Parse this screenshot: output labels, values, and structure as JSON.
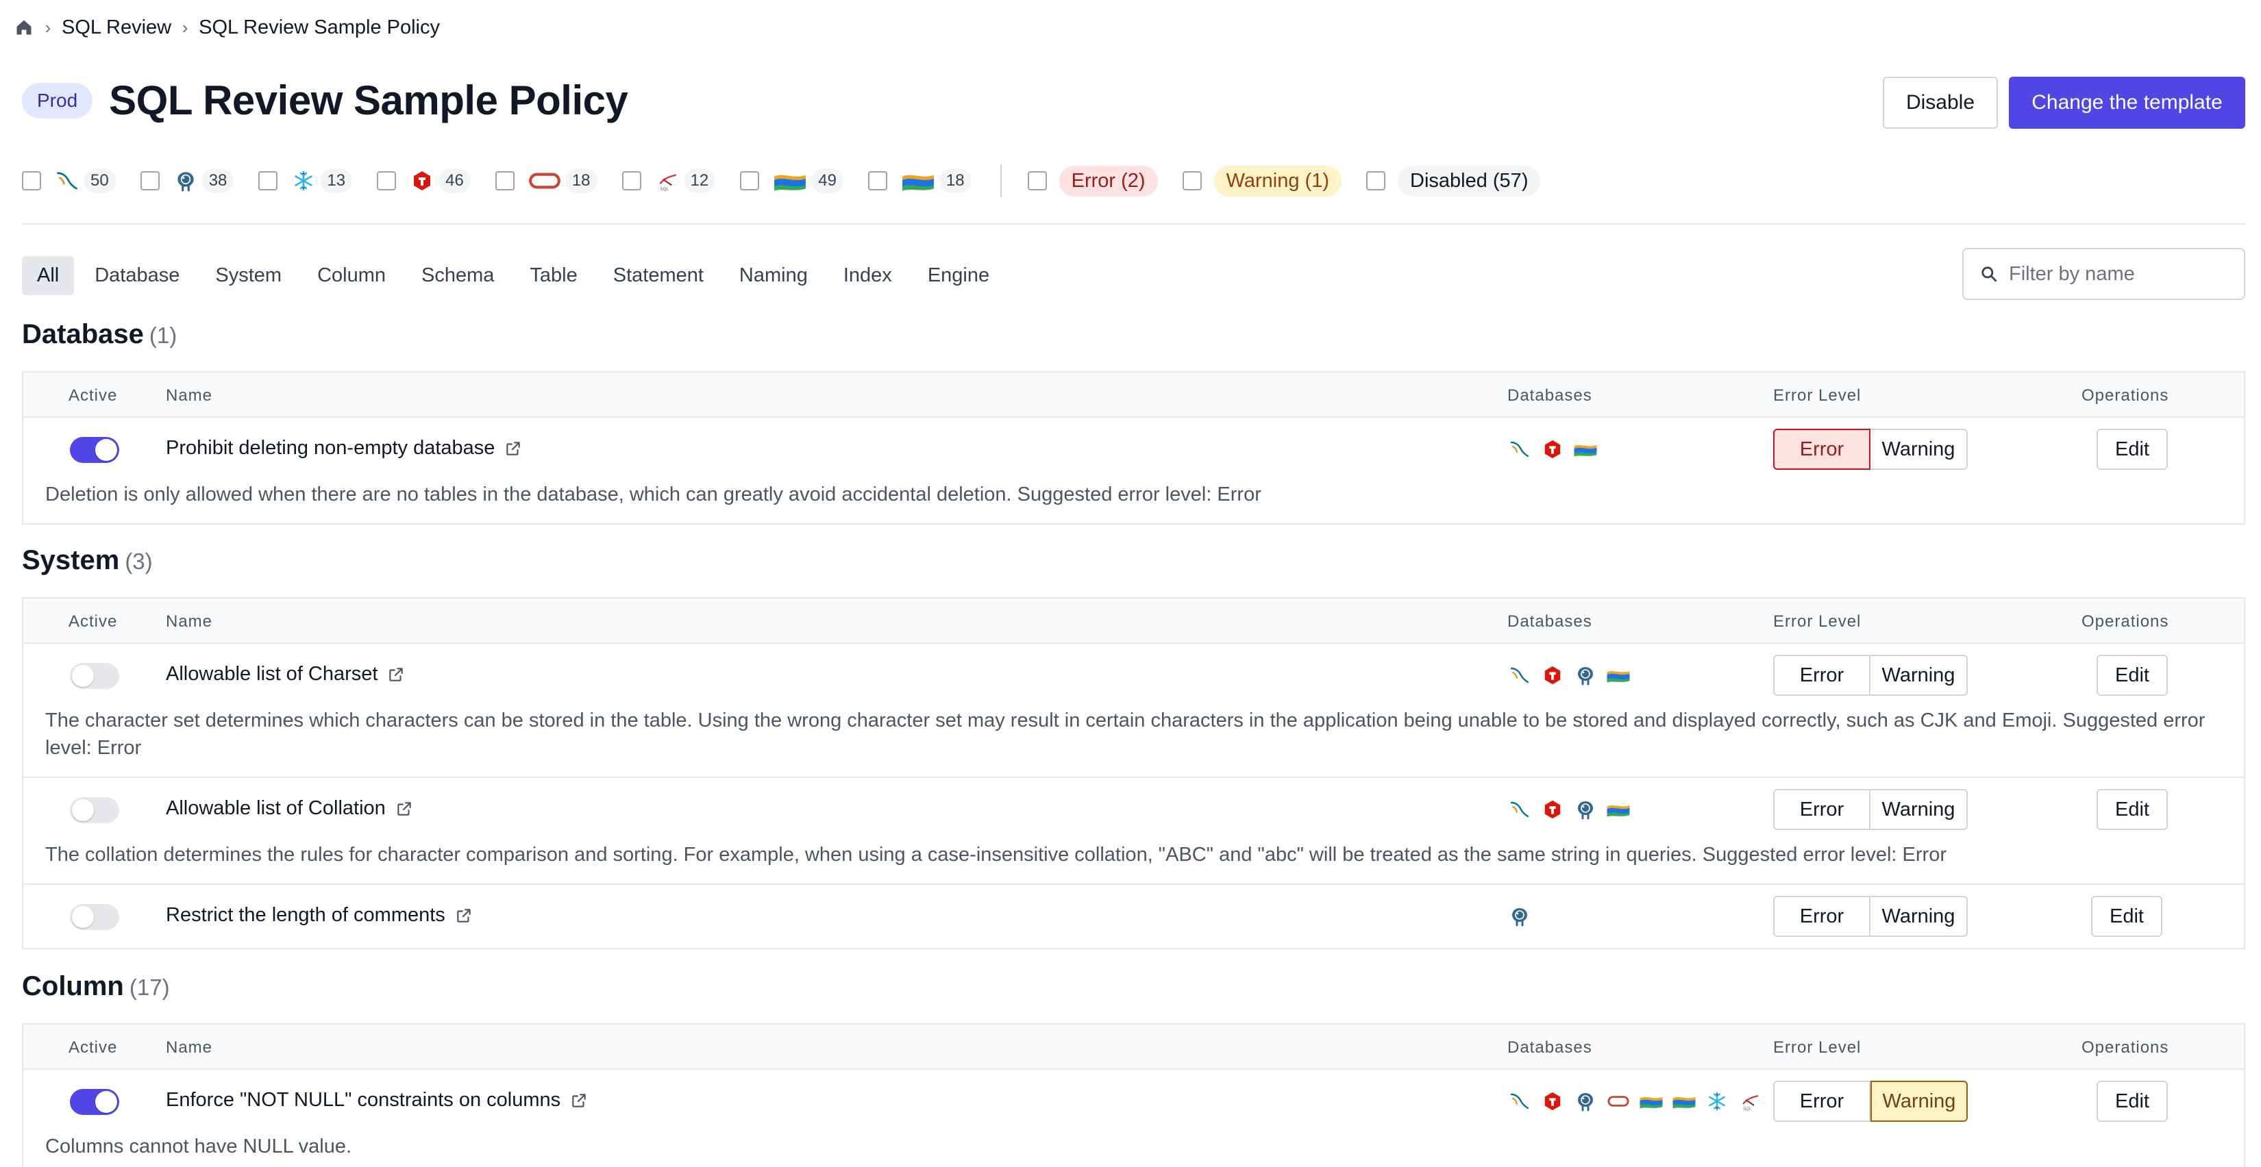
{
  "breadcrumb": {
    "items": [
      "SQL Review",
      "SQL Review Sample Policy"
    ]
  },
  "header": {
    "env": "Prod",
    "title": "SQL Review Sample Policy",
    "disable_label": "Disable",
    "change_label": "Change the template"
  },
  "engine_filters": [
    {
      "icon": "mysql-icon",
      "count": "50"
    },
    {
      "icon": "postgresql-icon",
      "count": "38"
    },
    {
      "icon": "snowflake-icon",
      "count": "13"
    },
    {
      "icon": "tidb-icon",
      "count": "46"
    },
    {
      "icon": "oracle-icon",
      "count": "18"
    },
    {
      "icon": "sqlserver-icon",
      "count": "12"
    },
    {
      "icon": "oceanbase-icon",
      "count": "49"
    },
    {
      "icon": "oceanbase-oracle-icon",
      "count": "18"
    }
  ],
  "level_filters": {
    "error": "Error (2)",
    "warning": "Warning (1)",
    "disabled": "Disabled (57)"
  },
  "tabs": [
    "All",
    "Database",
    "System",
    "Column",
    "Schema",
    "Table",
    "Statement",
    "Naming",
    "Index",
    "Engine"
  ],
  "search": {
    "placeholder": "Filter by name"
  },
  "columns": {
    "active": "Active",
    "name": "Name",
    "databases": "Databases",
    "error_level": "Error Level",
    "operations": "Operations"
  },
  "levels": {
    "error": "Error",
    "warning": "Warning",
    "edit": "Edit"
  },
  "sections": {
    "database": {
      "title": "Database",
      "count": "(1)",
      "rules": [
        {
          "name": "Prohibit deleting non-empty database",
          "active": true,
          "level": "error",
          "desc": "Deletion is only allowed when there are no tables in the database, which can greatly avoid accidental deletion. Suggested error level: Error"
        }
      ]
    },
    "system": {
      "title": "System",
      "count": "(3)",
      "rules": [
        {
          "name": "Allowable list of Charset",
          "active": false,
          "desc": "The character set determines which characters can be stored in the table. Using the wrong character set may result in certain characters in the application being unable to be stored and displayed correctly, such as CJK and Emoji. Suggested error level: Error"
        },
        {
          "name": "Allowable list of Collation",
          "active": false,
          "desc": "The collation determines the rules for character comparison and sorting. For example, when using a case-insensitive collation, \"ABC\" and \"abc\" will be treated as the same string in queries. Suggested error level: Error"
        },
        {
          "name": "Restrict the length of comments",
          "active": false,
          "desc": ""
        }
      ]
    },
    "column": {
      "title": "Column",
      "count": "(17)",
      "rules": [
        {
          "name": "Enforce \"NOT NULL\" constraints on columns",
          "active": true,
          "level": "warning",
          "desc": "Columns cannot have NULL value."
        }
      ]
    }
  },
  "colors": {
    "primary": "#4f46e5",
    "error_bg": "#fee2e2",
    "warning_bg": "#fef3c7"
  }
}
